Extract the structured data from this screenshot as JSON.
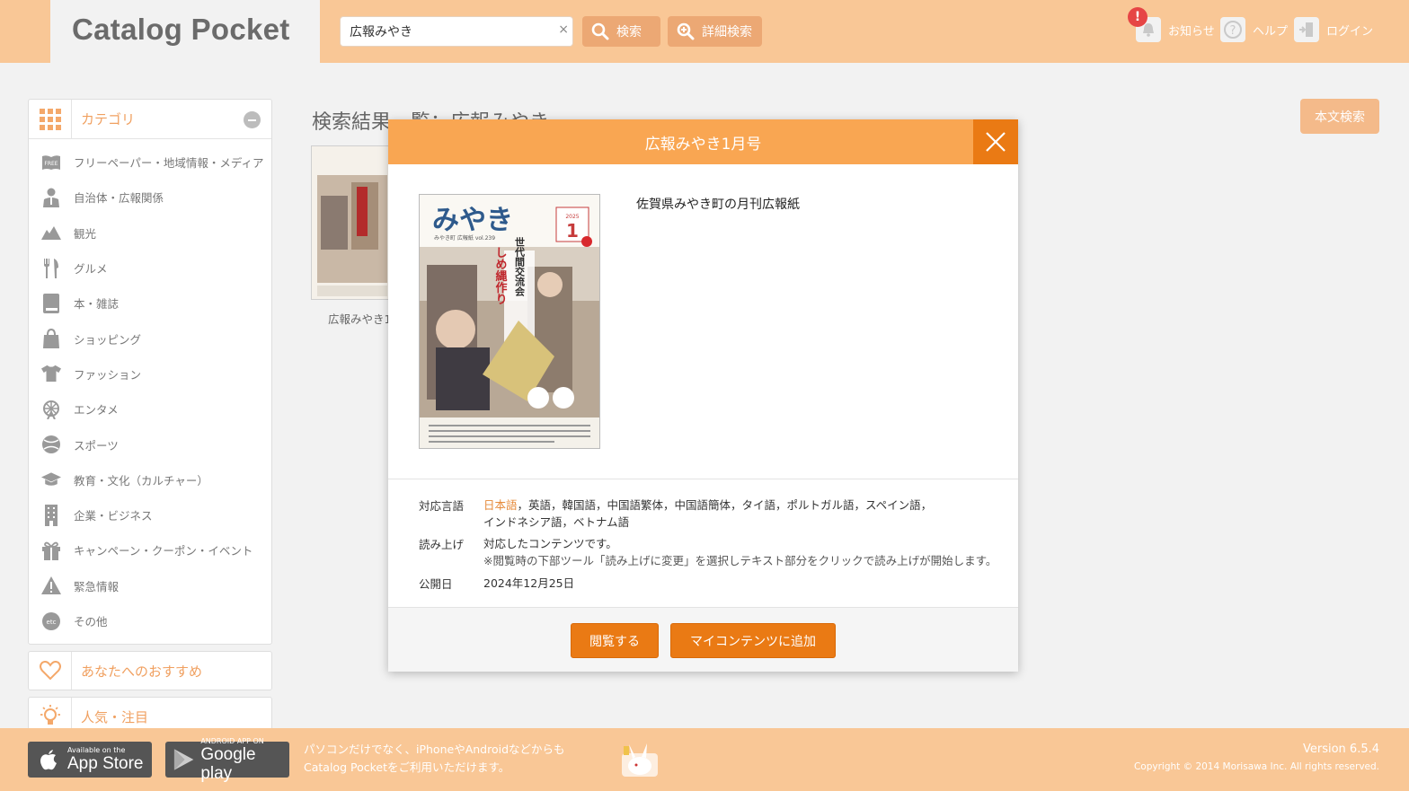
{
  "app": {
    "title": "Catalog Pocket"
  },
  "search": {
    "value": "広報みやき",
    "clear": "×",
    "button_label": "検索",
    "advanced_label": "詳細検索"
  },
  "topnav": {
    "notification_badge": "!",
    "news": "お知らせ",
    "help": "ヘルプ",
    "login": "ログイン"
  },
  "sidebar": {
    "category_title": "カテゴリ",
    "categories": [
      {
        "label": "フリーペーパー・地域情報・メディア",
        "icon": "free-paper-icon"
      },
      {
        "label": "自治体・広報関係",
        "icon": "official-person-icon"
      },
      {
        "label": "観光",
        "icon": "mountain-icon"
      },
      {
        "label": "グルメ",
        "icon": "fork-knife-icon"
      },
      {
        "label": "本・雑誌",
        "icon": "book-icon"
      },
      {
        "label": "ショッピング",
        "icon": "shopping-bag-icon"
      },
      {
        "label": "ファッション",
        "icon": "tshirt-icon"
      },
      {
        "label": "エンタメ",
        "icon": "ferris-wheel-icon"
      },
      {
        "label": "スポーツ",
        "icon": "ball-icon"
      },
      {
        "label": "教育・文化（カルチャー）",
        "icon": "graduation-cap-icon"
      },
      {
        "label": "企業・ビジネス",
        "icon": "building-icon"
      },
      {
        "label": "キャンペーン・クーポン・イベント",
        "icon": "gift-icon"
      },
      {
        "label": "緊急情報",
        "icon": "warning-icon"
      },
      {
        "label": "その他",
        "icon": "etc-icon"
      }
    ],
    "etc_icon_text": "etc",
    "recommend": "あなたへのおすすめ",
    "popular": "人気・注目"
  },
  "main": {
    "results_title": "検索結果一覧：広報みやき",
    "fulltext_button": "本文検索",
    "result_items": [
      {
        "label": "広報みやき1"
      }
    ]
  },
  "cover": {
    "title": "みやき",
    "subtitle": "みやき町 広報紙 vol.239",
    "year": "2025",
    "month": "1",
    "headline": "世代間交流会",
    "headline2": "しめ縄作り"
  },
  "modal": {
    "title": "広報みやき1月号",
    "description": "佐賀県みやき町の月刊広報紙",
    "languages_label": "対応言語",
    "language_current": "日本語",
    "languages_line1": "，英語，韓国語，中国語繁体，中国語簡体，タイ語，ポルトガル語，スペイン語，",
    "languages_line2": "インドネシア語，ベトナム語",
    "readaloud_label": "読み上げ",
    "readaloud_value": "対応したコンテンツです。",
    "readaloud_note": "※閲覧時の下部ツール「読み上げに変更」を選択しテキスト部分をクリックで読み上げが開始します。",
    "published_label": "公開日",
    "published_value": "2024年12月25日",
    "read_button": "閲覧する",
    "add_button": "マイコンテンツに追加"
  },
  "footer": {
    "appstore_small": "Available on the",
    "appstore_big": "App Store",
    "gplay_small": "ANDROID APP ON",
    "gplay_big": "Google play",
    "line1": "パソコンだけでなく、iPhoneやAndroidなどからも",
    "line2": "Catalog Pocketをご利用いただけます。",
    "version": "Version 6.5.4",
    "copyright": "Copyright © 2014 Morisawa Inc. All rights reserved."
  },
  "colors": {
    "header_bg": "#f9c796",
    "accent": "#ea7a14",
    "modal_head": "#f9a652",
    "category_text": "#f0a060"
  }
}
